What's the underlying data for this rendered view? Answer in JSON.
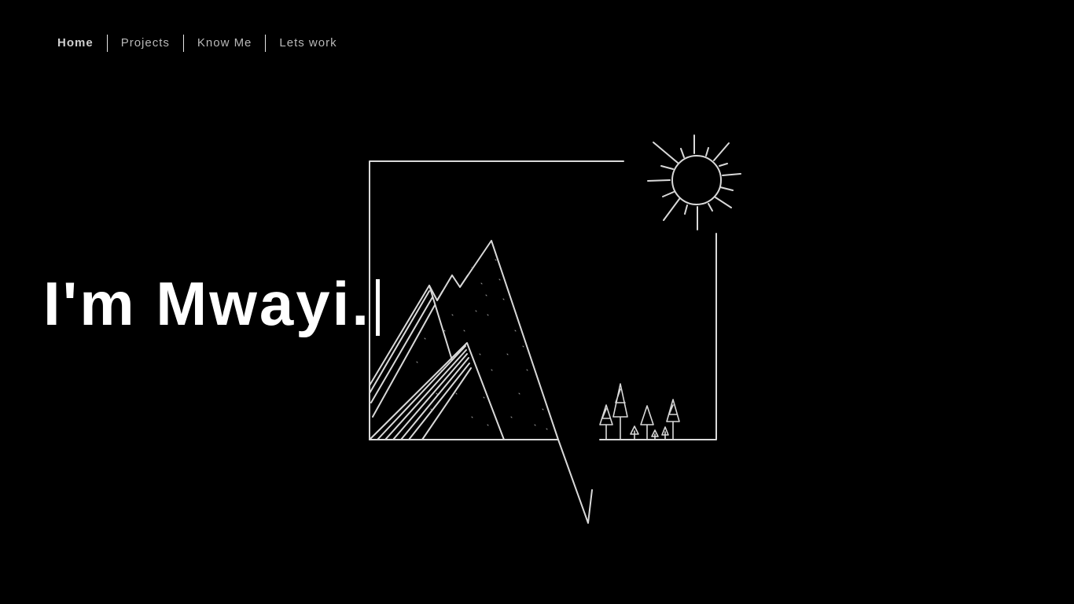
{
  "nav": {
    "items": [
      {
        "label": "Home",
        "active": true
      },
      {
        "label": "Projects",
        "active": false
      },
      {
        "label": "Know Me",
        "active": false
      },
      {
        "label": "Lets work",
        "active": false
      }
    ]
  },
  "hero": {
    "headline": "I'm Mwayi."
  },
  "illustration": {
    "subject": "line-art mountains, sun and trees in a frame",
    "stroke_color": "#d9d9d9"
  },
  "colors": {
    "background": "#000000",
    "text": "#ffffff",
    "nav_text": "#b8b8b8"
  }
}
